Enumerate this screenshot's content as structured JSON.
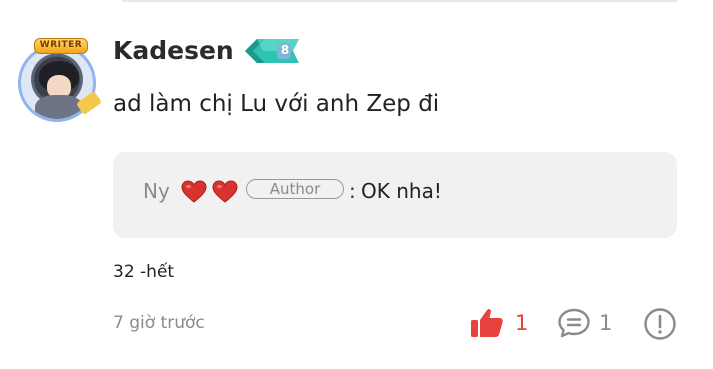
{
  "comment": {
    "avatar_badge": "WRITER",
    "username": "Kadesen",
    "level": "8",
    "text": "ad làm chị Lu với anh Zep đi",
    "chapter": "32 -hết",
    "timestamp": "7 giờ trước",
    "like_count": "1",
    "reply_count": "1"
  },
  "reply": {
    "author": "Ny",
    "author_tag": "Author",
    "colon": ":",
    "text": "OK nha!"
  },
  "colors": {
    "like_accent": "#e8413e",
    "muted_text": "#8b8b8b",
    "level_badge": "#2fc4b2",
    "reply_box_bg": "#f1f1f1"
  },
  "icons": {
    "like": "thumbs-up-icon",
    "reply": "speech-bubble-icon",
    "report": "exclamation-circle-icon",
    "hearts": "heart-icon"
  }
}
